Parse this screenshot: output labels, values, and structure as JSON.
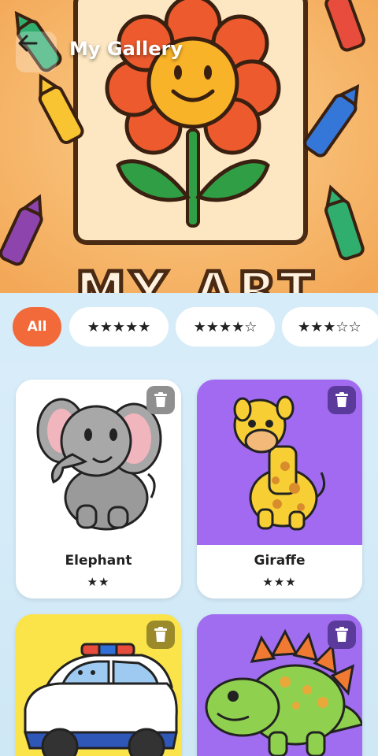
{
  "header": {
    "title": "My Gallery",
    "back_icon": "arrow-left-icon",
    "banner_text": "MY ART"
  },
  "filters": [
    {
      "label": "All",
      "active": true
    },
    {
      "label": "★★★★★",
      "active": false
    },
    {
      "label": "★★★★☆",
      "active": false
    },
    {
      "label": "★★★☆☆",
      "active": false
    }
  ],
  "cards": [
    {
      "name": "Elephant",
      "stars": "★★",
      "rating": 2,
      "bg": "#ffffff"
    },
    {
      "name": "Giraffe",
      "stars": "★★★",
      "rating": 3,
      "bg": "#a26af0"
    },
    {
      "name": "",
      "stars": "",
      "rating": null,
      "bg": "#fbe34a"
    },
    {
      "name": "",
      "stars": "",
      "rating": null,
      "bg": "#a06cf0"
    }
  ],
  "colors": {
    "accent": "#f2693a",
    "background": "#d7ecf8",
    "hero": "#f6b869"
  }
}
